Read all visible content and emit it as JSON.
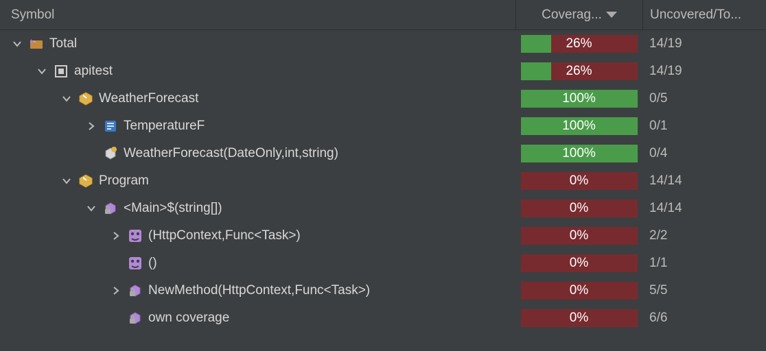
{
  "columns": {
    "symbol": "Symbol",
    "coverage": "Coverag...",
    "uncovered": "Uncovered/To..."
  },
  "rows": [
    {
      "depth": 0,
      "chev": "down",
      "icon": "folder",
      "label": "Total",
      "pct": 26,
      "unc": "14/19"
    },
    {
      "depth": 1,
      "chev": "down",
      "icon": "module",
      "label": "apitest",
      "pct": 26,
      "unc": "14/19"
    },
    {
      "depth": 2,
      "chev": "down",
      "icon": "class",
      "label": "WeatherForecast",
      "pct": 100,
      "unc": "0/5"
    },
    {
      "depth": 3,
      "chev": "right",
      "icon": "prop",
      "label": "TemperatureF",
      "pct": 100,
      "unc": "0/1"
    },
    {
      "depth": 3,
      "chev": "none",
      "icon": "method",
      "label": "WeatherForecast(DateOnly,int,string)",
      "pct": 100,
      "unc": "0/4"
    },
    {
      "depth": 2,
      "chev": "down",
      "icon": "class",
      "label": "Program",
      "pct": 0,
      "unc": "14/14"
    },
    {
      "depth": 3,
      "chev": "down",
      "icon": "lockpkg",
      "label": "<Main>$(string[])",
      "pct": 0,
      "unc": "14/14"
    },
    {
      "depth": 4,
      "chev": "right",
      "icon": "lambda",
      "label": "(HttpContext,Func<Task>)",
      "pct": 0,
      "unc": "2/2"
    },
    {
      "depth": 4,
      "chev": "none",
      "icon": "lambda",
      "label": "()",
      "pct": 0,
      "unc": "1/1"
    },
    {
      "depth": 4,
      "chev": "right",
      "icon": "lockpkg",
      "label": "NewMethod(HttpContext,Func<Task>)",
      "pct": 0,
      "unc": "5/5"
    },
    {
      "depth": 4,
      "chev": "none",
      "icon": "lockpkg",
      "label": "own coverage",
      "pct": 0,
      "unc": "6/6"
    }
  ]
}
